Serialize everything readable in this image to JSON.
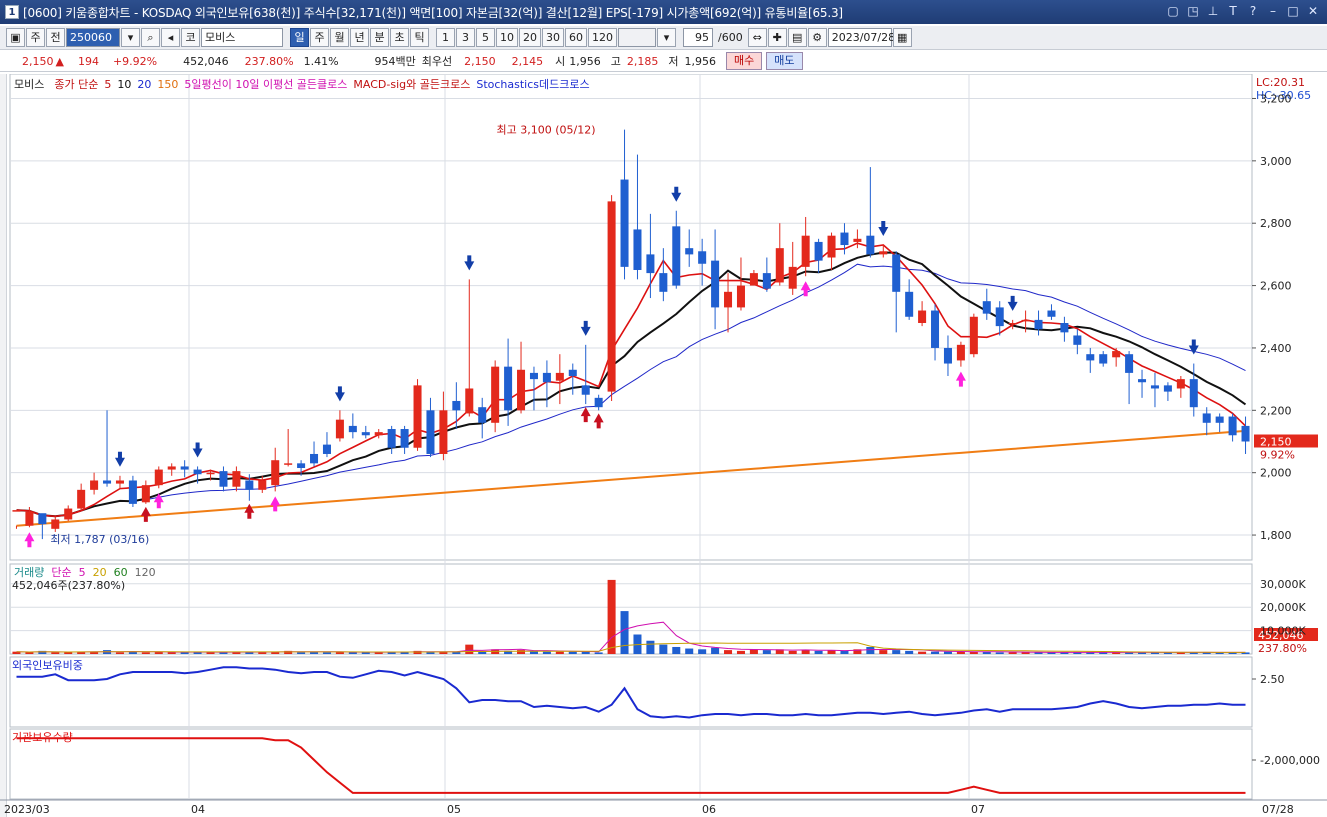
{
  "titlebar": {
    "num": "1",
    "text": "[0600] 키움종합차트 - KOSDAQ 외국인보유[638(천)] 주식수[32,171(천)] 액면[100] 자본금[32(억)] 결산[12월] EPS[-179] 시가총액[692(억)] 유통비율[65.3]",
    "ctrls": [
      "▢",
      "◳",
      "⊥",
      "T",
      "?",
      "–",
      "□",
      "✕"
    ]
  },
  "toolbar": {
    "period_primary": "주",
    "prev_label": "전",
    "code": "250060",
    "market": "코",
    "name": "모비스",
    "periods": [
      "일",
      "주",
      "월",
      "년",
      "분",
      "초",
      "틱"
    ],
    "selected_period": "일",
    "intervals": [
      "1",
      "3",
      "5",
      "10",
      "20",
      "30",
      "60",
      "120"
    ],
    "count": "95",
    "count_total": "/600",
    "date": "2023/07/28"
  },
  "quote": {
    "price": "2,150",
    "change_arrow": "▲",
    "change": "194",
    "change_pct": "+9.92%",
    "volume": "452,046",
    "volume_pct": "237.80%",
    "turnover": "1.41%",
    "amount": "954백만",
    "pref_label": "최우선",
    "ask": "2,150",
    "bid": "2,145",
    "open_label": "시",
    "open": "1,956",
    "high_label": "고",
    "high": "2,185",
    "low_label": "저",
    "low": "1,956",
    "buy_label": "매수",
    "sell_label": "매도"
  },
  "price_panel": {
    "legend": [
      {
        "text": "모비스",
        "color": "#222222"
      },
      {
        "text": "종가 단순",
        "color": "#c01010"
      },
      {
        "text": "5",
        "color": "#c01010"
      },
      {
        "text": "10",
        "color": "#111111"
      },
      {
        "text": "20",
        "color": "#1a2ad0"
      },
      {
        "text": "150",
        "color": "#e07010"
      },
      {
        "text": "5일평선이 10일 이평선 골든클로스",
        "color": "#d010b0"
      },
      {
        "text": "MACD-sig와 골든크로스",
        "color": "#c01010"
      },
      {
        "text": "Stochastics데드크로스",
        "color": "#1a2ad0"
      }
    ],
    "lc": "LC:20.31",
    "hc": "HC:-30.65",
    "yticks": [
      "3,200",
      "3,000",
      "2,800",
      "2,600",
      "2,400",
      "2,200",
      "2,000",
      "1,800"
    ],
    "last_price_tag": "2,150",
    "last_pct_tag": "9.92%",
    "max_label": "최고 3,100 (05/12)",
    "min_label": "최저 1,787 (03/16)"
  },
  "volume_panel": {
    "legend": [
      {
        "text": "거래량",
        "color": "#1a8a8a"
      },
      {
        "text": "단순",
        "color": "#d010b0"
      },
      {
        "text": "5",
        "color": "#d010b0"
      },
      {
        "text": "20",
        "color": "#c8a000"
      },
      {
        "text": "60",
        "color": "#208020"
      },
      {
        "text": "120",
        "color": "#666666"
      }
    ],
    "sub": "452,046주(237.80%)",
    "yticks": [
      "30,000K",
      "20,000K",
      "10,000K"
    ],
    "tag": "452,046",
    "tag2": "237.80%"
  },
  "foreign_panel": {
    "title": "외국인보유비중",
    "ytick": "2.50"
  },
  "inst_panel": {
    "title": "기관보유수량",
    "ytick": "-2,000,000"
  },
  "x_axis": {
    "labels": [
      "2023/03",
      "04",
      "05",
      "06",
      "07"
    ],
    "end_label": "07/28"
  },
  "chart_data": {
    "type": "candlestick",
    "candles": [
      [
        1875,
        1880,
        1830,
        1820
      ],
      [
        1830,
        1875,
        1890,
        1825
      ],
      [
        1870,
        1835,
        1850,
        1787
      ],
      [
        1820,
        1850,
        1860,
        1810
      ],
      [
        1850,
        1885,
        1895,
        1845
      ],
      [
        1885,
        1945,
        1965,
        1880
      ],
      [
        1945,
        1975,
        2000,
        1930
      ],
      [
        1975,
        1965,
        2200,
        1955
      ],
      [
        1965,
        1975,
        1990,
        1950
      ],
      [
        1975,
        1900,
        1990,
        1890
      ],
      [
        1905,
        1960,
        1975,
        1900
      ],
      [
        1960,
        2010,
        2020,
        1950
      ],
      [
        2010,
        2020,
        2030,
        1990
      ],
      [
        2020,
        2010,
        2040,
        1985
      ],
      [
        2010,
        1995,
        2020,
        1965
      ],
      [
        1995,
        2000,
        2010,
        1975
      ],
      [
        2005,
        1955,
        2020,
        1940
      ],
      [
        1955,
        2005,
        2020,
        1940
      ],
      [
        1975,
        1945,
        1995,
        1910
      ],
      [
        1945,
        1975,
        1990,
        1935
      ],
      [
        1960,
        2040,
        2080,
        1940
      ],
      [
        2030,
        2030,
        2140,
        2020
      ],
      [
        2030,
        2015,
        2040,
        1990
      ],
      [
        2060,
        2030,
        2100,
        2020
      ],
      [
        2090,
        2060,
        2130,
        2050
      ],
      [
        2110,
        2170,
        2200,
        2100
      ],
      [
        2150,
        2130,
        2190,
        2110
      ],
      [
        2130,
        2120,
        2150,
        2110
      ],
      [
        2120,
        2130,
        2140,
        2110
      ],
      [
        2140,
        2080,
        2150,
        2060
      ],
      [
        2140,
        2080,
        2150,
        2060
      ],
      [
        2080,
        2280,
        2300,
        2070
      ],
      [
        2200,
        2060,
        2240,
        2050
      ],
      [
        2060,
        2200,
        2260,
        2040
      ],
      [
        2230,
        2200,
        2290,
        2140
      ],
      [
        2190,
        2270,
        2620,
        2180
      ],
      [
        2210,
        2160,
        2240,
        2110
      ],
      [
        2160,
        2340,
        2360,
        2130
      ],
      [
        2340,
        2200,
        2430,
        2150
      ],
      [
        2200,
        2330,
        2420,
        2190
      ],
      [
        2320,
        2300,
        2340,
        2200
      ],
      [
        2320,
        2290,
        2360,
        2210
      ],
      [
        2295,
        2320,
        2380,
        2220
      ],
      [
        2330,
        2310,
        2350,
        2250
      ],
      [
        2280,
        2250,
        2410,
        2220
      ],
      [
        2240,
        2210,
        2250,
        2200
      ],
      [
        2260,
        2870,
        2890,
        2230
      ],
      [
        2940,
        2660,
        3100,
        2620
      ],
      [
        2780,
        2650,
        3020,
        2620
      ],
      [
        2700,
        2640,
        2830,
        2560
      ],
      [
        2640,
        2580,
        2720,
        2550
      ],
      [
        2790,
        2600,
        2840,
        2590
      ],
      [
        2720,
        2700,
        2780,
        2660
      ],
      [
        2710,
        2670,
        2750,
        2600
      ],
      [
        2680,
        2530,
        2780,
        2460
      ],
      [
        2530,
        2580,
        2640,
        2450
      ],
      [
        2530,
        2600,
        2690,
        2520
      ],
      [
        2600,
        2640,
        2650,
        2620
      ],
      [
        2640,
        2590,
        2690,
        2580
      ],
      [
        2610,
        2720,
        2800,
        2600
      ],
      [
        2590,
        2660,
        2740,
        2570
      ],
      [
        2660,
        2760,
        2820,
        2630
      ],
      [
        2740,
        2680,
        2750,
        2640
      ],
      [
        2690,
        2760,
        2770,
        2650
      ],
      [
        2770,
        2730,
        2800,
        2700
      ],
      [
        2740,
        2750,
        2780,
        2720
      ],
      [
        2760,
        2700,
        2980,
        2690
      ],
      [
        2700,
        2710,
        2730,
        2690
      ],
      [
        2700,
        2580,
        2710,
        2450
      ],
      [
        2580,
        2500,
        2620,
        2490
      ],
      [
        2480,
        2520,
        2550,
        2470
      ],
      [
        2520,
        2400,
        2540,
        2360
      ],
      [
        2400,
        2350,
        2440,
        2310
      ],
      [
        2360,
        2410,
        2420,
        2340
      ],
      [
        2380,
        2500,
        2510,
        2370
      ],
      [
        2550,
        2510,
        2590,
        2490
      ],
      [
        2530,
        2470,
        2550,
        2440
      ],
      [
        2480,
        2480,
        2490,
        2460
      ],
      [
        2490,
        2490,
        2520,
        2450
      ],
      [
        2490,
        2460,
        2520,
        2440
      ],
      [
        2520,
        2500,
        2540,
        2490
      ],
      [
        2480,
        2450,
        2500,
        2420
      ],
      [
        2440,
        2410,
        2460,
        2380
      ],
      [
        2380,
        2360,
        2400,
        2320
      ],
      [
        2380,
        2350,
        2390,
        2340
      ],
      [
        2370,
        2390,
        2400,
        2340
      ],
      [
        2380,
        2320,
        2390,
        2220
      ],
      [
        2300,
        2290,
        2330,
        2240
      ],
      [
        2280,
        2270,
        2320,
        2210
      ],
      [
        2280,
        2260,
        2290,
        2230
      ],
      [
        2270,
        2300,
        2310,
        2240
      ],
      [
        2300,
        2210,
        2350,
        2180
      ],
      [
        2190,
        2160,
        2210,
        2120
      ],
      [
        2180,
        2160,
        2190,
        2130
      ],
      [
        2180,
        2120,
        2190,
        2100
      ],
      [
        2150,
        2100,
        2180,
        2060
      ]
    ],
    "volume": [
      3,
      2,
      4,
      2,
      2,
      3,
      3,
      5,
      2,
      3,
      2,
      3,
      2,
      2,
      3,
      2,
      2,
      3,
      2,
      3,
      3,
      4,
      2,
      3,
      2,
      3,
      2,
      2,
      2,
      3,
      3,
      4,
      2,
      3,
      3,
      12,
      3,
      6,
      4,
      5,
      4,
      3,
      3,
      3,
      3,
      2,
      95,
      55,
      25,
      17,
      12,
      9,
      7,
      6,
      8,
      5,
      4,
      6,
      5,
      6,
      4,
      5,
      4,
      5,
      4,
      6,
      9,
      5,
      5,
      4,
      3,
      3,
      3,
      3,
      3,
      3,
      2,
      2,
      2,
      2,
      2,
      2,
      2,
      2,
      2,
      2,
      2,
      2,
      2,
      2,
      2,
      2,
      2,
      2,
      2,
      2,
      2,
      2,
      3,
      3,
      2,
      3,
      2,
      3,
      2,
      3,
      2,
      2,
      4
    ],
    "foreign_pct": [
      2.52,
      2.52,
      2.52,
      2.54,
      2.49,
      2.49,
      2.49,
      2.5,
      2.54,
      2.56,
      2.56,
      2.56,
      2.56,
      2.55,
      2.56,
      2.58,
      2.6,
      2.6,
      2.59,
      2.59,
      2.58,
      2.56,
      2.55,
      2.56,
      2.56,
      2.52,
      2.51,
      2.54,
      2.57,
      2.56,
      2.53,
      2.56,
      2.53,
      2.5,
      2.42,
      2.3,
      2.32,
      2.32,
      2.31,
      2.31,
      2.26,
      2.27,
      2.26,
      2.25,
      2.26,
      2.22,
      2.28,
      2.42,
      2.24,
      2.18,
      2.17,
      2.18,
      2.17,
      2.19,
      2.2,
      2.2,
      2.19,
      2.2,
      2.2,
      2.19,
      2.19,
      2.2,
      2.19,
      2.19,
      2.2,
      2.21,
      2.21,
      2.2,
      2.21,
      2.22,
      2.2,
      2.19,
      2.2,
      2.21,
      2.23,
      2.24,
      2.22,
      2.24,
      2.24,
      2.24,
      2.24,
      2.25,
      2.26,
      2.29,
      2.31,
      2.29,
      2.26,
      2.25,
      2.26,
      2.27,
      2.27,
      2.28,
      2.28,
      2.29,
      2.28,
      2.28,
      2.28,
      2.3,
      2.33,
      2.38,
      2.43,
      2.44,
      2.44,
      2.44
    ],
    "inst_qty": [
      0.55,
      0.55,
      0.55,
      0.55,
      0.55,
      0.55,
      0.55,
      0.55,
      0.55,
      0.55,
      0.55,
      0.55,
      0.55,
      0.55,
      0.55,
      0.55,
      0.55,
      0.55,
      0.55,
      0.55,
      0.53,
      0.53,
      0.46,
      0.34,
      0.22,
      0.12,
      0.02,
      0.02,
      0.02,
      0.02,
      0.02,
      0.02,
      0.02,
      0.02,
      0.02,
      0.02,
      0.02,
      0.02,
      0.02,
      0.02,
      0.02,
      0.02,
      0.02,
      0.02,
      0.02,
      0.02,
      0.02,
      0.02,
      0.02,
      0.02,
      0.02,
      0.02,
      0.02,
      0.02,
      0.02,
      0.02,
      0.02,
      0.02,
      0.02,
      0.02,
      0.02,
      0.02,
      0.02,
      0.02,
      0.02,
      0.02,
      0.02,
      0.02,
      0.02,
      0.02,
      0.02,
      0.02,
      0.02,
      0.02,
      0.02,
      0.02,
      0.02,
      0.02,
      0.02,
      0.02,
      0.02,
      0.02,
      0.02,
      0.02,
      0.02,
      0.02,
      0.02,
      0.02,
      0.02,
      0.02,
      0.02,
      0.02,
      0.02,
      0.02,
      0.02,
      0.02,
      0.02,
      0.02,
      0.02,
      0.02,
      0.02
    ],
    "price_range": [
      1720,
      3240
    ]
  },
  "colors": {
    "up": "#e3291c",
    "down": "#1f5fd0",
    "ma5": "#d11",
    "ma10": "#111",
    "ma20": "#2028c8",
    "ma150": "#f07d14",
    "grid": "#d9dde4"
  }
}
